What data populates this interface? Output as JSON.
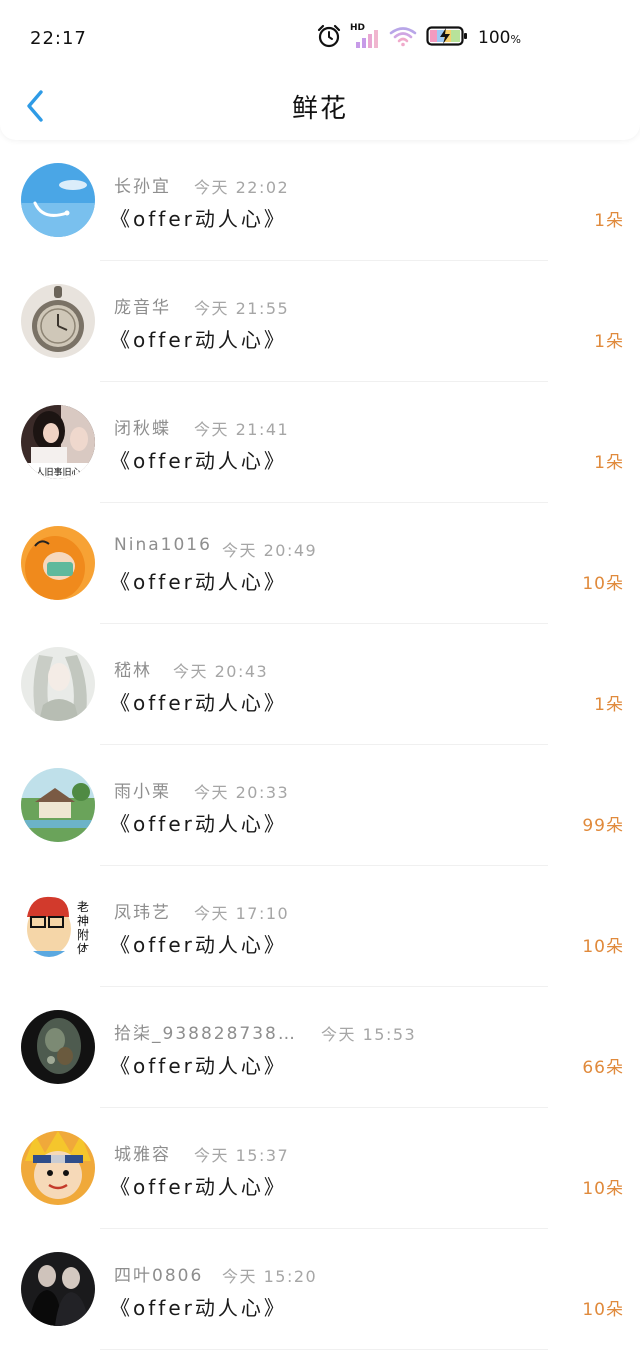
{
  "status_bar": {
    "time": "22:17",
    "battery": "100",
    "battery_unit": "%",
    "network_label": "HD",
    "icons": [
      "alarm-icon",
      "signal-icon",
      "wifi-icon",
      "battery-icon"
    ]
  },
  "nav": {
    "title": "鲜花",
    "back_icon": "chevron-left-icon"
  },
  "colors": {
    "accent": "#2e9be6",
    "amount": "#e08a3c",
    "name": "#8e8e8e",
    "timestamp": "#a6a6a6"
  },
  "items": [
    {
      "name": "长孙宜",
      "time": "今天 22:02",
      "show": "《offer动人心》",
      "amount": "1朵"
    },
    {
      "name": "庞音华",
      "time": "今天 21:55",
      "show": "《offer动人心》",
      "amount": "1朵"
    },
    {
      "name": "闭秋蝶",
      "time": "今天 21:41",
      "show": "《offer动人心》",
      "amount": "1朵",
      "avatar_text": "人旧事旧心"
    },
    {
      "name": "Nina1016",
      "time": "今天 20:49",
      "show": "《offer动人心》",
      "amount": "10朵"
    },
    {
      "name": "嵇林",
      "time": "今天 20:43",
      "show": "《offer动人心》",
      "amount": "1朵"
    },
    {
      "name": "雨小栗",
      "time": "今天 20:33",
      "show": "《offer动人心》",
      "amount": "99朵"
    },
    {
      "name": "凤玮艺",
      "time": "今天 17:10",
      "show": "《offer动人心》",
      "amount": "10朵",
      "avatar_text": [
        "老",
        "神",
        "附",
        "体"
      ]
    },
    {
      "name": "拾柒_938828738…",
      "time": "今天 15:53",
      "show": "《offer动人心》",
      "amount": "66朵"
    },
    {
      "name": "城雅容",
      "time": "今天 15:37",
      "show": "《offer动人心》",
      "amount": "10朵"
    },
    {
      "name": "四叶0806",
      "time": "今天 15:20",
      "show": "《offer动人心》",
      "amount": "10朵"
    }
  ]
}
